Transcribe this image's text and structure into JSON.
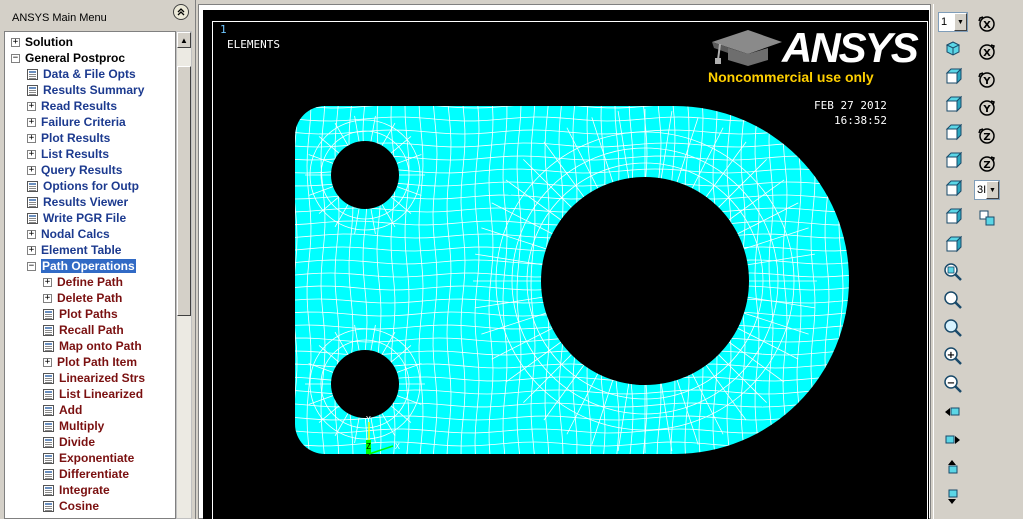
{
  "menu": {
    "title": "ANSYS Main Menu",
    "collapse_icon": "double-chevron-up-icon",
    "items": [
      {
        "label": "Solution",
        "kind": "expander",
        "expander": "+",
        "depth": 0,
        "color": "black"
      },
      {
        "label": "General Postproc",
        "kind": "expander",
        "expander": "−",
        "depth": 0,
        "color": "black"
      },
      {
        "label": "Data & File Opts",
        "kind": "doc",
        "depth": 1,
        "color": "blue"
      },
      {
        "label": "Results Summary",
        "kind": "doc",
        "depth": 1,
        "color": "blue"
      },
      {
        "label": "Read Results",
        "kind": "expander",
        "expander": "+",
        "depth": 1,
        "color": "blue"
      },
      {
        "label": "Failure Criteria",
        "kind": "expander",
        "expander": "+",
        "depth": 1,
        "color": "blue"
      },
      {
        "label": "Plot Results",
        "kind": "expander",
        "expander": "+",
        "depth": 1,
        "color": "blue"
      },
      {
        "label": "List Results",
        "kind": "expander",
        "expander": "+",
        "depth": 1,
        "color": "blue"
      },
      {
        "label": "Query Results",
        "kind": "expander",
        "expander": "+",
        "depth": 1,
        "color": "blue"
      },
      {
        "label": "Options for Outp",
        "kind": "doc",
        "depth": 1,
        "color": "blue"
      },
      {
        "label": "Results Viewer",
        "kind": "doc",
        "depth": 1,
        "color": "blue"
      },
      {
        "label": "Write PGR File",
        "kind": "doc",
        "depth": 1,
        "color": "blue"
      },
      {
        "label": "Nodal Calcs",
        "kind": "expander",
        "expander": "+",
        "depth": 1,
        "color": "blue"
      },
      {
        "label": "Element Table",
        "kind": "expander",
        "expander": "+",
        "depth": 1,
        "color": "blue"
      },
      {
        "label": "Path Operations",
        "kind": "expander",
        "expander": "−",
        "depth": 1,
        "color": "blue",
        "selected": true
      },
      {
        "label": "Define Path",
        "kind": "expander",
        "expander": "+",
        "depth": 2,
        "color": "maroon"
      },
      {
        "label": "Delete Path",
        "kind": "expander",
        "expander": "+",
        "depth": 2,
        "color": "maroon"
      },
      {
        "label": "Plot Paths",
        "kind": "doc",
        "depth": 2,
        "color": "maroon"
      },
      {
        "label": "Recall Path",
        "kind": "doc",
        "depth": 2,
        "color": "maroon"
      },
      {
        "label": "Map onto Path",
        "kind": "doc",
        "depth": 2,
        "color": "maroon"
      },
      {
        "label": "Plot Path Item",
        "kind": "expander",
        "expander": "+",
        "depth": 2,
        "color": "maroon"
      },
      {
        "label": "Linearized Strs",
        "kind": "doc",
        "depth": 2,
        "color": "maroon"
      },
      {
        "label": "List Linearized",
        "kind": "doc",
        "depth": 2,
        "color": "maroon"
      },
      {
        "label": "Add",
        "kind": "doc",
        "depth": 2,
        "color": "maroon"
      },
      {
        "label": "Multiply",
        "kind": "doc",
        "depth": 2,
        "color": "maroon"
      },
      {
        "label": "Divide",
        "kind": "doc",
        "depth": 2,
        "color": "maroon"
      },
      {
        "label": "Exponentiate",
        "kind": "doc",
        "depth": 2,
        "color": "maroon"
      },
      {
        "label": "Differentiate",
        "kind": "doc",
        "depth": 2,
        "color": "maroon"
      },
      {
        "label": "Integrate",
        "kind": "doc",
        "depth": 2,
        "color": "maroon"
      },
      {
        "label": "Cosine",
        "kind": "doc",
        "depth": 2,
        "color": "maroon"
      }
    ]
  },
  "graphics": {
    "window_number": "1",
    "plot_label": "ELEMENTS",
    "date": "FEB 27 2012",
    "time": "16:38:52",
    "logo_text": "ANSYS",
    "logo_subtext": "Noncommercial use only",
    "background_color": "#000000",
    "mesh_fill_color": "#00ffff",
    "mesh_line_color": "#ffffff",
    "triad_labels": {
      "y": "Y",
      "z": "Z",
      "x": "X"
    }
  },
  "toolbar": {
    "window_select_value": "1",
    "view_select_value": "3I",
    "view_buttons": [
      "iso-view-icon",
      "oblique-view-icon",
      "front-view-icon",
      "back-view-icon",
      "top-view-icon",
      "bottom-view-icon",
      "left-view-icon",
      "right-view-icon"
    ],
    "rotate_buttons": [
      "rotate-x-plus-icon",
      "rotate-x-minus-icon",
      "rotate-y-plus-icon",
      "rotate-y-minus-icon",
      "rotate-z-plus-icon",
      "rotate-z-minus-icon"
    ],
    "zoom_buttons": [
      "zoom-fit-icon",
      "zoom-icon",
      "zoom-back-icon",
      "zoom-in-icon",
      "zoom-out-icon"
    ],
    "pan_buttons": [
      "pan-left-icon",
      "pan-right-icon",
      "pan-up-icon",
      "pan-down-icon"
    ],
    "extra_button": "dynamic-mode-icon"
  }
}
